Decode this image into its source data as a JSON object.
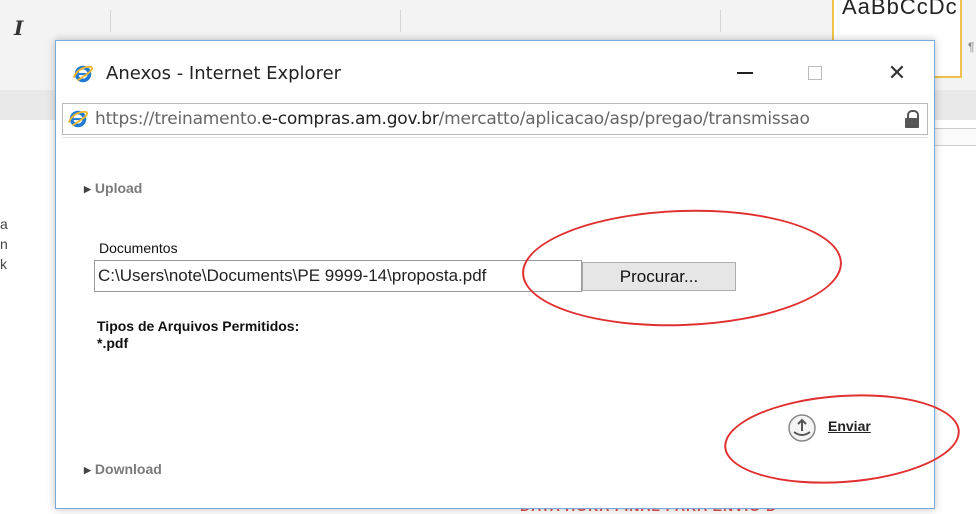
{
  "background": {
    "italic_glyph": "I",
    "style_preview": "AaBbCcDc",
    "pilcrow": "¶",
    "side_text_lines": [
      "a",
      "n",
      "k"
    ],
    "red_banner": "DATA HORA FINAL PARA ENVIO D"
  },
  "window": {
    "title": "Anexos - Internet Explorer",
    "minimize_label": "—",
    "close_label": "✕",
    "address": {
      "scheme": "https://",
      "subdomain": "treinamento.",
      "domain": "e-compras.am.gov.br",
      "path": "/mercatto/aplicacao/asp/pregao/transmissao"
    }
  },
  "upload": {
    "section_label": "Upload",
    "documents_label": "Documentos",
    "file_path": "C:\\Users\\note\\Documents\\PE 9999-14\\proposta.pdf",
    "browse_button": "Procurar...",
    "allowed_types_label": "Tipos de Arquivos Permitidos:",
    "allowed_types_value": "*.pdf",
    "send_label": "Enviar"
  },
  "download": {
    "section_label": "Download"
  },
  "colors": {
    "annotation": "#e03030",
    "ie_blue": "#1f7ad4",
    "window_border": "#7aa8d8"
  },
  "icons": [
    "ie-logo-icon",
    "lock-icon",
    "upload-send-icon",
    "triangle-right-icon"
  ]
}
